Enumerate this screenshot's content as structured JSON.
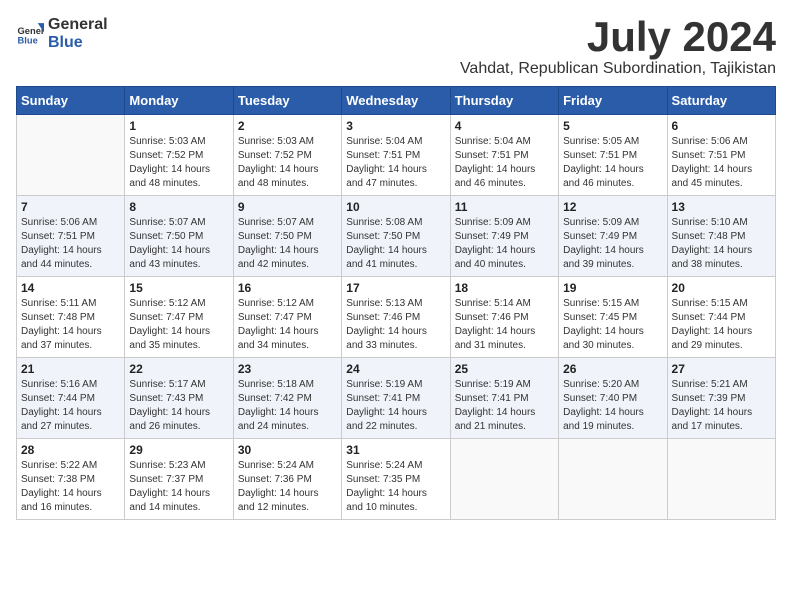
{
  "logo": {
    "general": "General",
    "blue": "Blue"
  },
  "title": "July 2024",
  "location": "Vahdat, Republican Subordination, Tajikistan",
  "days_header": [
    "Sunday",
    "Monday",
    "Tuesday",
    "Wednesday",
    "Thursday",
    "Friday",
    "Saturday"
  ],
  "weeks": [
    [
      {
        "day": "",
        "info": ""
      },
      {
        "day": "1",
        "info": "Sunrise: 5:03 AM\nSunset: 7:52 PM\nDaylight: 14 hours\nand 48 minutes."
      },
      {
        "day": "2",
        "info": "Sunrise: 5:03 AM\nSunset: 7:52 PM\nDaylight: 14 hours\nand 48 minutes."
      },
      {
        "day": "3",
        "info": "Sunrise: 5:04 AM\nSunset: 7:51 PM\nDaylight: 14 hours\nand 47 minutes."
      },
      {
        "day": "4",
        "info": "Sunrise: 5:04 AM\nSunset: 7:51 PM\nDaylight: 14 hours\nand 46 minutes."
      },
      {
        "day": "5",
        "info": "Sunrise: 5:05 AM\nSunset: 7:51 PM\nDaylight: 14 hours\nand 46 minutes."
      },
      {
        "day": "6",
        "info": "Sunrise: 5:06 AM\nSunset: 7:51 PM\nDaylight: 14 hours\nand 45 minutes."
      }
    ],
    [
      {
        "day": "7",
        "info": "Sunrise: 5:06 AM\nSunset: 7:51 PM\nDaylight: 14 hours\nand 44 minutes."
      },
      {
        "day": "8",
        "info": "Sunrise: 5:07 AM\nSunset: 7:50 PM\nDaylight: 14 hours\nand 43 minutes."
      },
      {
        "day": "9",
        "info": "Sunrise: 5:07 AM\nSunset: 7:50 PM\nDaylight: 14 hours\nand 42 minutes."
      },
      {
        "day": "10",
        "info": "Sunrise: 5:08 AM\nSunset: 7:50 PM\nDaylight: 14 hours\nand 41 minutes."
      },
      {
        "day": "11",
        "info": "Sunrise: 5:09 AM\nSunset: 7:49 PM\nDaylight: 14 hours\nand 40 minutes."
      },
      {
        "day": "12",
        "info": "Sunrise: 5:09 AM\nSunset: 7:49 PM\nDaylight: 14 hours\nand 39 minutes."
      },
      {
        "day": "13",
        "info": "Sunrise: 5:10 AM\nSunset: 7:48 PM\nDaylight: 14 hours\nand 38 minutes."
      }
    ],
    [
      {
        "day": "14",
        "info": "Sunrise: 5:11 AM\nSunset: 7:48 PM\nDaylight: 14 hours\nand 37 minutes."
      },
      {
        "day": "15",
        "info": "Sunrise: 5:12 AM\nSunset: 7:47 PM\nDaylight: 14 hours\nand 35 minutes."
      },
      {
        "day": "16",
        "info": "Sunrise: 5:12 AM\nSunset: 7:47 PM\nDaylight: 14 hours\nand 34 minutes."
      },
      {
        "day": "17",
        "info": "Sunrise: 5:13 AM\nSunset: 7:46 PM\nDaylight: 14 hours\nand 33 minutes."
      },
      {
        "day": "18",
        "info": "Sunrise: 5:14 AM\nSunset: 7:46 PM\nDaylight: 14 hours\nand 31 minutes."
      },
      {
        "day": "19",
        "info": "Sunrise: 5:15 AM\nSunset: 7:45 PM\nDaylight: 14 hours\nand 30 minutes."
      },
      {
        "day": "20",
        "info": "Sunrise: 5:15 AM\nSunset: 7:44 PM\nDaylight: 14 hours\nand 29 minutes."
      }
    ],
    [
      {
        "day": "21",
        "info": "Sunrise: 5:16 AM\nSunset: 7:44 PM\nDaylight: 14 hours\nand 27 minutes."
      },
      {
        "day": "22",
        "info": "Sunrise: 5:17 AM\nSunset: 7:43 PM\nDaylight: 14 hours\nand 26 minutes."
      },
      {
        "day": "23",
        "info": "Sunrise: 5:18 AM\nSunset: 7:42 PM\nDaylight: 14 hours\nand 24 minutes."
      },
      {
        "day": "24",
        "info": "Sunrise: 5:19 AM\nSunset: 7:41 PM\nDaylight: 14 hours\nand 22 minutes."
      },
      {
        "day": "25",
        "info": "Sunrise: 5:19 AM\nSunset: 7:41 PM\nDaylight: 14 hours\nand 21 minutes."
      },
      {
        "day": "26",
        "info": "Sunrise: 5:20 AM\nSunset: 7:40 PM\nDaylight: 14 hours\nand 19 minutes."
      },
      {
        "day": "27",
        "info": "Sunrise: 5:21 AM\nSunset: 7:39 PM\nDaylight: 14 hours\nand 17 minutes."
      }
    ],
    [
      {
        "day": "28",
        "info": "Sunrise: 5:22 AM\nSunset: 7:38 PM\nDaylight: 14 hours\nand 16 minutes."
      },
      {
        "day": "29",
        "info": "Sunrise: 5:23 AM\nSunset: 7:37 PM\nDaylight: 14 hours\nand 14 minutes."
      },
      {
        "day": "30",
        "info": "Sunrise: 5:24 AM\nSunset: 7:36 PM\nDaylight: 14 hours\nand 12 minutes."
      },
      {
        "day": "31",
        "info": "Sunrise: 5:24 AM\nSunset: 7:35 PM\nDaylight: 14 hours\nand 10 minutes."
      },
      {
        "day": "",
        "info": ""
      },
      {
        "day": "",
        "info": ""
      },
      {
        "day": "",
        "info": ""
      }
    ]
  ]
}
